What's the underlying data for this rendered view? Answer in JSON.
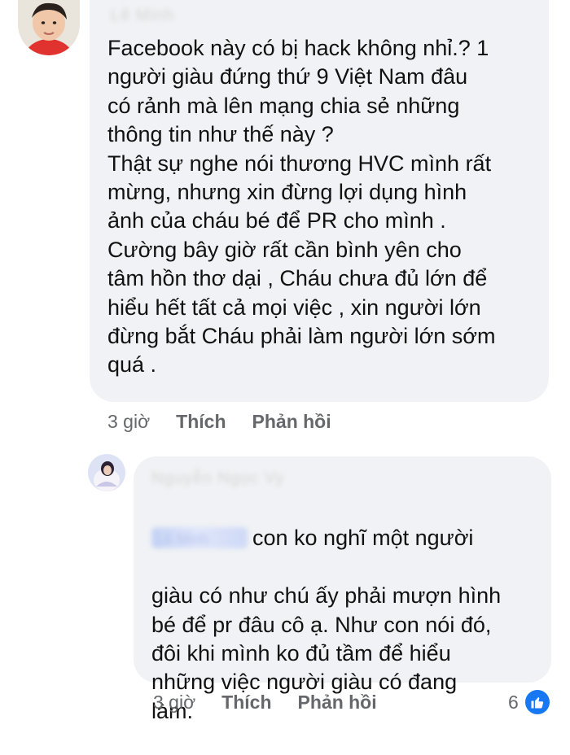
{
  "comments": [
    {
      "author": "Lê Minh",
      "text": "Facebook này có bị hack không nhỉ.? 1\nngười giàu đứng thứ 9 Việt Nam đâu\ncó rảnh mà lên mạng chia sẻ những\nthông tin như thế này ?\nThật sự nghe nói thương HVC mình rất\nmừng,  nhưng xin đừng lợi dụng hình\nảnh của cháu bé để PR cho mình .\nCường bây giờ rất cần bình yên cho\ntâm hồn thơ dại , Cháu chưa đủ lớn để\nhiểu hết  tất cả mọi việc , xin người lớn\nđừng bắt Cháu phải làm người lớn sớm\nquá .",
      "time": "3 giờ",
      "like_label": "Thích",
      "reply_label": "Phản hồi"
    },
    {
      "author": "Nguyễn Ngọc Vy",
      "mention": "Lê Minh",
      "text_first_line": "con ko nghĩ một người",
      "text_rest": "giàu có như chú ấy phải mượn hình\nbé để pr đâu cô ạ. Như con nói đó,\nđôi khi mình ko đủ tầm để hiểu\nnhững việc người giàu có đang\nlàm.",
      "time": "3 giờ",
      "like_label": "Thích",
      "reply_label": "Phản hồi",
      "reaction_count": "6",
      "reaction_icon": "like-thumb-icon"
    }
  ],
  "colors": {
    "bubble": "#f0f2f5",
    "meta_text": "#65676b",
    "like_blue": "#1877f2"
  }
}
